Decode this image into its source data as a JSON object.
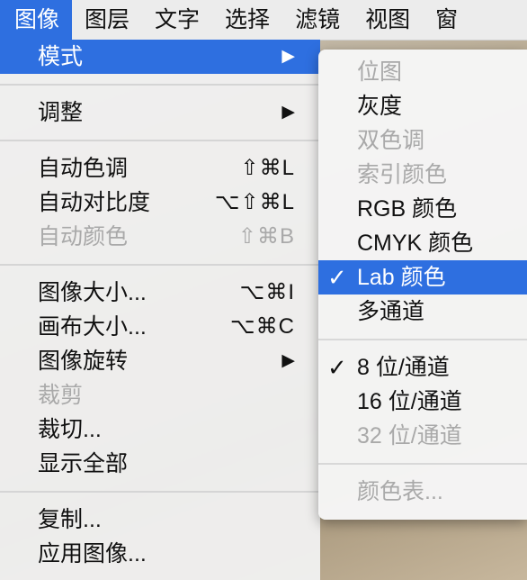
{
  "menubar": {
    "items": [
      "图像",
      "图层",
      "文字",
      "选择",
      "滤镜",
      "视图",
      "窗"
    ]
  },
  "menu": {
    "mode": "模式",
    "adjust": "调整",
    "auto_tone": "自动色调",
    "auto_tone_sc": "⇧⌘L",
    "auto_contrast": "自动对比度",
    "auto_contrast_sc": "⌥⇧⌘L",
    "auto_color": "自动颜色",
    "auto_color_sc": "⇧⌘B",
    "image_size": "图像大小...",
    "image_size_sc": "⌥⌘I",
    "canvas_size": "画布大小...",
    "canvas_size_sc": "⌥⌘C",
    "rotation": "图像旋转",
    "crop": "裁剪",
    "trim": "裁切...",
    "reveal_all": "显示全部",
    "duplicate": "复制...",
    "apply_image": "应用图像...",
    "arrow": "▶"
  },
  "submenu": {
    "bitmap": "位图",
    "grayscale": "灰度",
    "duotone": "双色调",
    "indexed": "索引颜色",
    "rgb": "RGB 颜色",
    "cmyk": "CMYK 颜色",
    "lab": "Lab 颜色",
    "multichannel": "多通道",
    "bit8": "8 位/通道",
    "bit16": "16 位/通道",
    "bit32": "32 位/通道",
    "color_table": "颜色表...",
    "check": "✓"
  },
  "colors": {
    "accent": "#2e6fe0"
  }
}
